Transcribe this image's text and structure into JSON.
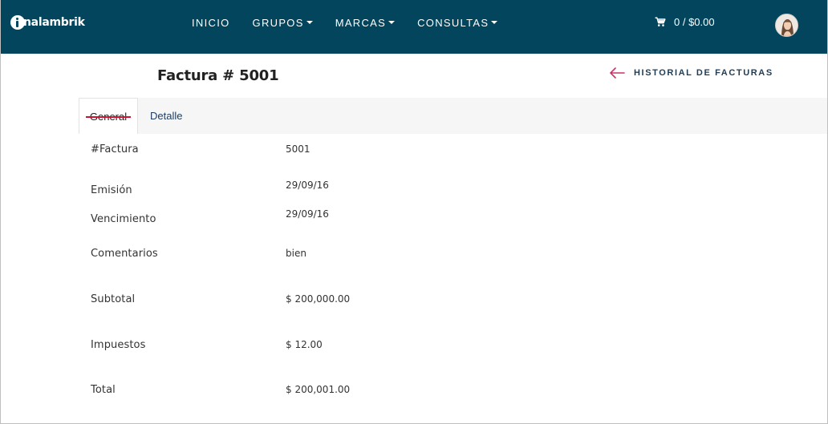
{
  "brand": {
    "logo_text": "nalambrik"
  },
  "nav": {
    "items": [
      {
        "label": "INICIO",
        "dropdown": false
      },
      {
        "label": "GRUPOS",
        "dropdown": true
      },
      {
        "label": "MARCAS",
        "dropdown": true
      },
      {
        "label": "CONSULTAS",
        "dropdown": true
      }
    ],
    "cart_summary": "0 / $0.00",
    "icons": {
      "cart": "cart-icon",
      "avatar": "user-avatar"
    }
  },
  "header": {
    "title": "Factura # 5001",
    "back_label": "HISTORIAL DE FACTURAS",
    "back_icon": "arrow-left-icon"
  },
  "tabs": [
    {
      "label": "General",
      "active": true
    },
    {
      "label": "Detalle",
      "active": false
    }
  ],
  "details": [
    {
      "label": "#Factura",
      "value": "5001"
    },
    {
      "label": "Emisión",
      "value": "29/09/16"
    },
    {
      "label": "Vencimiento",
      "value": "29/09/16"
    },
    {
      "label": "Comentarios",
      "value": "bien"
    },
    {
      "label": "Subtotal",
      "value": "$ 200,000.00"
    },
    {
      "label": "Impuestos",
      "value": "$ 12.00"
    },
    {
      "label": "Total",
      "value": "$ 200,001.00"
    }
  ],
  "colors": {
    "navbar": "#02455c",
    "tab_underline": "#d0112b",
    "back_arrow": "#c8326b"
  }
}
